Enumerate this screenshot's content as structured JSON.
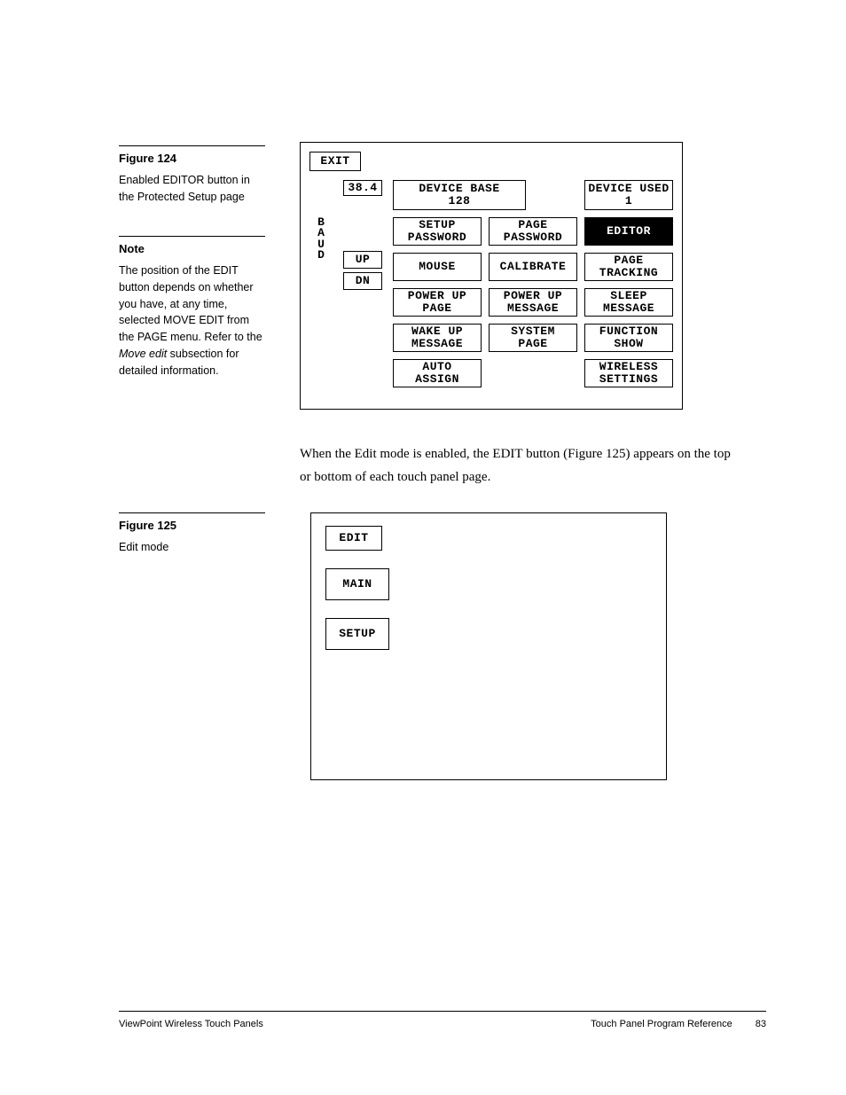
{
  "fig124": {
    "title": "Figure 124",
    "caption": "Enabled EDITOR button in the Protected Setup page"
  },
  "note": {
    "title": "Note",
    "text_before": "The position of the EDIT button depends on whether you have, at any time, selected MOVE EDIT from the PAGE menu. Refer to the ",
    "italic": "Move edit",
    "text_after": " subsection for detailed information."
  },
  "fig125": {
    "title": "Figure 125",
    "caption": "Edit mode"
  },
  "body": {
    "p1": "When the Edit mode is enabled, the EDIT button (Figure 125) appears on the top or bottom of each touch panel page."
  },
  "panel124": {
    "exit": "EXIT",
    "rate": "38.4",
    "baud": "BAUD",
    "up": "UP",
    "dn": "DN",
    "device_base": "DEVICE BASE\n128",
    "device_used": "DEVICE USED\n1",
    "setup_password": "SETUP\nPASSWORD",
    "page_password": "PAGE\nPASSWORD",
    "editor": "EDITOR",
    "mouse": "MOUSE",
    "calibrate": "CALIBRATE",
    "page_tracking": "PAGE\nTRACKING",
    "power_up_page": "POWER UP\nPAGE",
    "power_up_message": "POWER UP\nMESSAGE",
    "sleep_message": "SLEEP\nMESSAGE",
    "wake_up_message": "WAKE UP\nMESSAGE",
    "system_page": "SYSTEM\nPAGE",
    "function_show": "FUNCTION\nSHOW",
    "auto_assign": "AUTO\nASSIGN",
    "wireless_settings": "WIRELESS\nSETTINGS"
  },
  "panel125": {
    "edit": "EDIT",
    "main": "MAIN",
    "setup": "SETUP"
  },
  "footer": {
    "left": "ViewPoint Wireless Touch Panels",
    "right": "Touch Panel Program Reference",
    "page": "83"
  }
}
